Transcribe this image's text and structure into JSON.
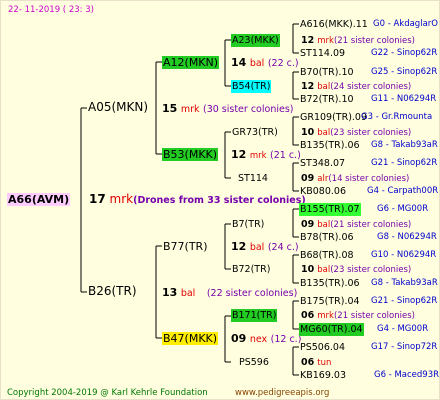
{
  "header": {
    "date": "22-  11-2019  (  23:   3)"
  },
  "footer": {
    "copyright": "Copyright 2004-2019 @ Karl Kehrle Foundation",
    "website": "www.pedigreeapis.org"
  },
  "root": {
    "id": "A66(AVM)",
    "year": "17",
    "mating": "mrk",
    "note": "(Drones from 33 sister colonies)"
  },
  "gen1": [
    {
      "id": "A05(MKN)",
      "year": "15",
      "mating": "mrk",
      "note": "(30 sister colonies)"
    },
    {
      "id": "B26(TR)",
      "year": "13",
      "mating": "bal",
      "note": "(22 sister colonies)"
    }
  ],
  "gen2": [
    {
      "id": "A12(MKN)",
      "year": "14",
      "mating": "bal",
      "note": "(22 c.)"
    },
    {
      "id": "B53(MKK)",
      "year": "12",
      "mating": "mrk",
      "note": "(21 c.)"
    },
    {
      "id": "B77(TR)",
      "year": "12",
      "mating": "bal",
      "note": "(24 c.)"
    },
    {
      "id": "B47(MKK)",
      "year": "09",
      "mating": "nex",
      "note": "(12 c.)"
    }
  ],
  "gen3": [
    {
      "id": "A23(MKK)",
      "year": "12",
      "mating": "mrk",
      "note": "(21 sister colonies)"
    },
    {
      "id": "B54(TR)",
      "year": "12",
      "mating": "bal",
      "note": "(24 sister colonies)"
    },
    {
      "id": "GR73(TR)",
      "year": "10",
      "mating": "bal",
      "note": "(23 sister colonies)"
    },
    {
      "id": "ST114",
      "year": "09",
      "mating": "alr",
      "note": "(14 sister colonies)"
    },
    {
      "id": "B7(TR)",
      "year": "09",
      "mating": "bal",
      "note": "(21 sister colonies)"
    },
    {
      "id": "B72(TR)",
      "year": "10",
      "mating": "bal",
      "note": "(23 sister colonies)"
    },
    {
      "id": "B171(TR)",
      "year": "06",
      "mating": "mrk",
      "note": "(21 sister colonies)"
    },
    {
      "id": "PS596",
      "year": "06",
      "mating": "tun",
      "note": ""
    }
  ],
  "gen4": [
    {
      "id": "A616(MKK).11",
      "code": "G0 - AkdaglarO"
    },
    {
      "id": "ST114.09",
      "code": "G22 - Sinop62R"
    },
    {
      "id": "B70(TR).10",
      "code": "G25 - Sinop62R"
    },
    {
      "id": "B72(TR).10",
      "code": "G11 - N06294R"
    },
    {
      "id": "GR109(TR).09",
      "code": "G3 - Gr.Rmounta"
    },
    {
      "id": "B135(TR).06",
      "code": "G8 - Takab93aR"
    },
    {
      "id": "ST348.07",
      "code": "G21 - Sinop62R"
    },
    {
      "id": "KB080.06",
      "code": "G4 - Carpath00R"
    },
    {
      "id": "B155(TR).07",
      "code": "G6 - MG00R"
    },
    {
      "id": "B78(TR).06",
      "code": "G8 - N06294R"
    },
    {
      "id": "B68(TR).08",
      "code": "G10 - N06294R"
    },
    {
      "id": "B135(TR).06",
      "code": "G8 - Takab93aR"
    },
    {
      "id": "B175(TR).04",
      "code": "G21 - Sinop62R"
    },
    {
      "id": "MG60(TR).04",
      "code": "G4 - MG00R"
    },
    {
      "id": "PS506.04",
      "code": "G17 - Sinop72R"
    },
    {
      "id": "KB169.03",
      "code": "G6 - Maced93R"
    }
  ]
}
